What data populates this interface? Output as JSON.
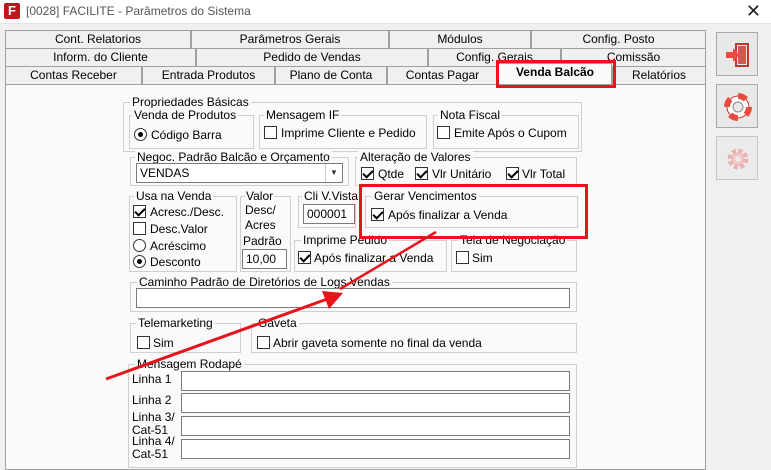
{
  "window": {
    "title": "[0028] FACILITE - Parâmetros do Sistema",
    "app_icon": "F"
  },
  "tabs": {
    "row1": [
      "Cont. Relatorios",
      "Parâmetros Gerais",
      "Módulos",
      "Config. Posto"
    ],
    "row2": [
      "Inform. do Cliente",
      "Pedido de Vendas",
      "Config. Gerais",
      "Comissão"
    ],
    "row3": [
      "Contas Receber",
      "Entrada Produtos",
      "Plano de Conta",
      "Contas Pagar",
      "Venda Balcão",
      "Relatórios"
    ],
    "active": "Venda Balcão"
  },
  "propriedades": {
    "title": "Propriedades Básicas",
    "venda_produtos": {
      "title": "Venda de Produtos",
      "option": "Código Barra",
      "selected": true
    },
    "mensagem_if": {
      "title": "Mensagem IF",
      "option": "Imprime Cliente e Pedido",
      "checked": false
    },
    "nota_fiscal": {
      "title": "Nota Fiscal",
      "option": "Emite Após o Cupom",
      "checked": false
    }
  },
  "negoc": {
    "title": "Negoc. Padrão Balcão e Orçamento",
    "value": "VENDAS"
  },
  "alteracao": {
    "title": "Alteração de Valores",
    "items": [
      {
        "label": "Qtde",
        "checked": true
      },
      {
        "label": "Vlr Unitário",
        "checked": true
      },
      {
        "label": "Vlr Total",
        "checked": true
      }
    ]
  },
  "usa_venda": {
    "title": "Usa na Venda",
    "checks": [
      {
        "label": "Acresc./Desc.",
        "checked": true
      },
      {
        "label": "Desc.Valor",
        "checked": false
      }
    ],
    "radios": [
      {
        "label": "Acréscimo",
        "selected": false
      },
      {
        "label": "Desconto",
        "selected": true
      }
    ]
  },
  "valor_desc": {
    "title_lines": [
      "Valor",
      "Desc/",
      "Acres",
      "Padrão"
    ],
    "value": "10,00"
  },
  "cli_vista": {
    "title": "Cli V.Vista",
    "value": "000001"
  },
  "gerar_vencimentos": {
    "title": "Gerar Vencimentos",
    "option": "Após finalizar a Venda",
    "checked": true
  },
  "imprime_pedido": {
    "title": "Imprime Pedido",
    "option": "Após finalizar a Venda",
    "checked": true
  },
  "tela_negociacao": {
    "title": "Tela de Negociação",
    "option": "Sim",
    "checked": false
  },
  "caminho_logs": {
    "title": "Caminho Padrão de Diretórios de Logs Vendas",
    "value": ""
  },
  "telemarketing": {
    "title": "Telemarketing",
    "option": "Sim",
    "checked": false
  },
  "gaveta": {
    "title": "Gaveta",
    "option": "Abrir gaveta somente no final da venda",
    "checked": false
  },
  "mensagem_rodape": {
    "title": "Mensagem Rodapé",
    "lines": [
      {
        "label": "Linha 1",
        "value": ""
      },
      {
        "label": "Linha 2",
        "value": ""
      },
      {
        "label": "Linha 3/\nCat-51",
        "value": ""
      },
      {
        "label": "Linha 4/\nCat-51",
        "value": ""
      }
    ]
  },
  "sidebar": {
    "buttons": [
      {
        "name": "exit",
        "icon": "exit-door-icon"
      },
      {
        "name": "help",
        "icon": "lifebuoy-icon"
      },
      {
        "name": "settings",
        "icon": "gear-icon",
        "enabled": false
      }
    ]
  },
  "colors": {
    "highlight": "#e8141c",
    "window_bg": "#f0f0f0",
    "panel_bg": "#fafafa"
  }
}
